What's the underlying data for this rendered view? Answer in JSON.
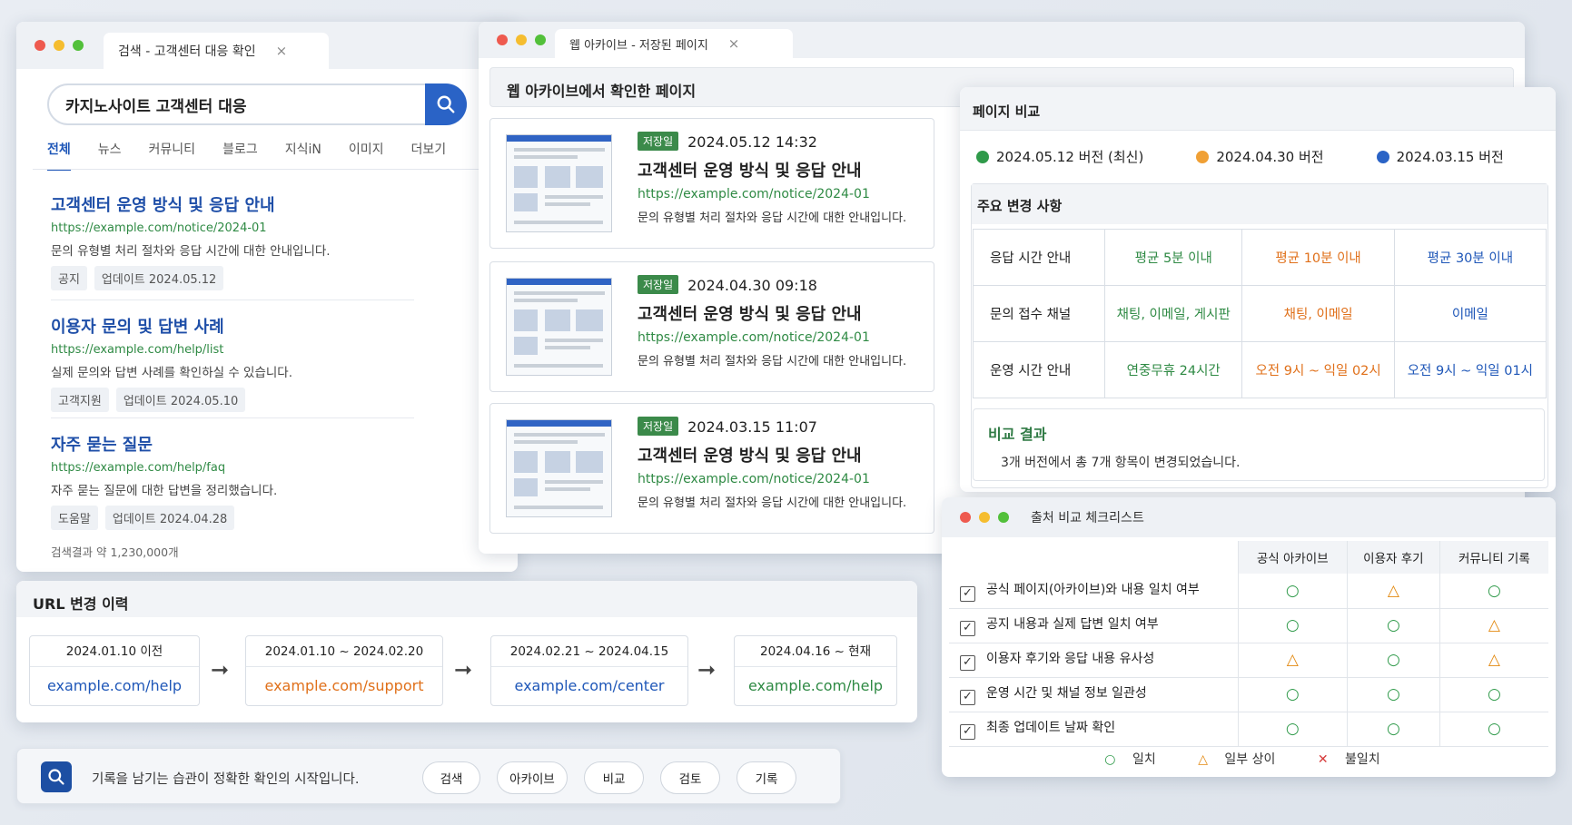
{
  "search_window": {
    "tab_title": "검색 - 고객센터 대응 확인",
    "tab_close": "×",
    "query": "카지노사이트 고객센터 대응",
    "tabs": [
      "전체",
      "뉴스",
      "커뮤니티",
      "블로그",
      "지식iN",
      "이미지",
      "더보기"
    ],
    "results": [
      {
        "title": "고객센터 운영 방식 및 응답 안내",
        "url": "https://example.com/notice/2024-01",
        "desc": "문의 유형별 처리 절차와 응답 시간에 대한 안내입니다.",
        "chips": [
          "공지",
          "업데이트 2024.05.12"
        ]
      },
      {
        "title": "이용자 문의 및 답변 사례",
        "url": "https://example.com/help/list",
        "desc": "실제 문의와 답변 사례를 확인하실 수 있습니다.",
        "chips": [
          "고객지원",
          "업데이트 2024.05.10"
        ]
      },
      {
        "title": "자주 묻는 질문",
        "url": "https://example.com/help/faq",
        "desc": "자주 묻는 질문에 대한 답변을 정리했습니다.",
        "chips": [
          "도움말",
          "업데이트 2024.04.28"
        ]
      }
    ],
    "result_count": "검색결과 약 1,230,000개"
  },
  "archive_window": {
    "tab_title": "웹 아카이브 - 저장된 페이지",
    "tab_close": "×",
    "heading": "웹 아카이브에서 확인한 페이지",
    "cards": [
      {
        "badge": "저장일",
        "date": "2024.05.12 14:32",
        "title": "고객센터 운영 방식 및 응답 안내",
        "url": "https://example.com/notice/2024-01",
        "desc": "문의 유형별 처리 절차와 응답 시간에 대한 안내입니다."
      },
      {
        "badge": "저장일",
        "date": "2024.04.30 09:18",
        "title": "고객센터 운영 방식 및 응답 안내",
        "url": "https://example.com/notice/2024-01",
        "desc": "문의 유형별 처리 절차와 응답 시간에 대한 안내입니다."
      },
      {
        "badge": "저장일",
        "date": "2024.03.15 11:07",
        "title": "고객센터 운영 방식 및 응답 안내",
        "url": "https://example.com/notice/2024-01",
        "desc": "문의 유형별 처리 절차와 응답 시간에 대한 안내입니다."
      }
    ]
  },
  "compare_window": {
    "title": "페이지 비교",
    "versions": [
      {
        "label": "2024.05.12 버전 (최신)",
        "color": "#2f9a4a"
      },
      {
        "label": "2024.04.30 버전",
        "color": "#f0a035"
      },
      {
        "label": "2024.03.15 버전",
        "color": "#2a63c6"
      }
    ],
    "changes_title": "주요 변경 사항",
    "rows": [
      {
        "key": "응답 시간 안내",
        "v1": "평균 5분 이내",
        "v2": "평균 10분 이내",
        "v3": "평균 30분 이내"
      },
      {
        "key": "문의 접수 채널",
        "v1": "채팅, 이메일, 게시판",
        "v2": "채팅, 이메일",
        "v3": "이메일"
      },
      {
        "key": "운영 시간 안내",
        "v1": "연중무휴 24시간",
        "v2": "오전 9시 ~ 익일 02시",
        "v3": "오전 9시 ~ 익일 01시"
      }
    ],
    "result_title": "비교 결과",
    "result_text": "3개 버전에서 총 7개 항목이 변경되었습니다."
  },
  "url_history": {
    "title": "URL 변경 이력",
    "entries": [
      {
        "period": "2024.01.10 이전",
        "url": "example.com/help",
        "color": "#1f57b8"
      },
      {
        "period": "2024.01.10 ~ 2024.02.20",
        "url": "example.com/support",
        "color": "#e0701a"
      },
      {
        "period": "2024.02.21 ~ 2024.04.15",
        "url": "example.com/center",
        "color": "#1f57b8"
      },
      {
        "period": "2024.04.16 ~ 현재",
        "url": "example.com/help",
        "color": "#2f8a44"
      }
    ],
    "arrow": "➞"
  },
  "footer": {
    "text": "기록을 남기는 습관이 정확한 확인의 시작입니다.",
    "buttons": [
      "검색",
      "아카이브",
      "비교",
      "검토",
      "기록"
    ]
  },
  "checklist": {
    "title": "출처 비교 체크리스트",
    "columns": [
      "공식 아카이브",
      "이용자 후기",
      "커뮤니티 기록"
    ],
    "rows": [
      {
        "label": "공식 페이지(아카이브)와 내용 일치 여부",
        "marks": [
          "○",
          "△",
          "○"
        ]
      },
      {
        "label": "공지 내용과 실제 답변 일치 여부",
        "marks": [
          "○",
          "○",
          "△"
        ]
      },
      {
        "label": "이용자 후기와 응답 내용 유사성",
        "marks": [
          "△",
          "○",
          "△"
        ]
      },
      {
        "label": "운영 시간 및 채널 정보 일관성",
        "marks": [
          "○",
          "○",
          "○"
        ]
      },
      {
        "label": "최종 업데이트 날짜 확인",
        "marks": [
          "○",
          "○",
          "○"
        ]
      }
    ],
    "check_glyph": "✓",
    "legend": [
      {
        "sym": "○",
        "label": "일치",
        "color": "#2f9a4a"
      },
      {
        "sym": "△",
        "label": "일부 상이",
        "color": "#e38a12"
      },
      {
        "sym": "✕",
        "label": "불일치",
        "color": "#d63b3b"
      }
    ]
  }
}
